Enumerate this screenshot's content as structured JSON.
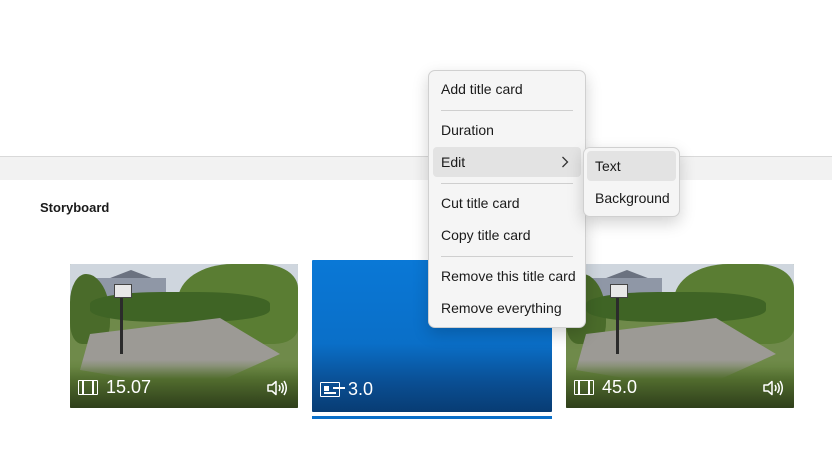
{
  "storyboard": {
    "title": "Storyboard",
    "clips": [
      {
        "kind": "video",
        "duration": "15.07",
        "type_icon": "film-icon",
        "audio_icon": "speaker-icon"
      },
      {
        "kind": "title-card",
        "duration": "3.0",
        "type_icon": "title-card-icon",
        "selected": true,
        "color": "#0a6fc8"
      },
      {
        "kind": "video",
        "duration": "45.0",
        "type_icon": "film-icon",
        "audio_icon": "speaker-icon"
      }
    ]
  },
  "context_menu": {
    "items": [
      {
        "label": "Add title card"
      },
      {
        "label": "Duration"
      },
      {
        "label": "Edit",
        "has_submenu": true,
        "highlighted": true
      },
      {
        "label": "Cut title card"
      },
      {
        "label": "Copy title card"
      },
      {
        "label": "Remove this title card"
      },
      {
        "label": "Remove everything"
      }
    ]
  },
  "submenu": {
    "items": [
      {
        "label": "Text",
        "highlighted": true
      },
      {
        "label": "Background"
      }
    ]
  },
  "colors": {
    "accent": "#0a6fc8",
    "menu_bg": "#f5f5f5",
    "menu_highlight": "#e3e3e3"
  }
}
